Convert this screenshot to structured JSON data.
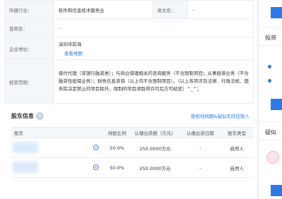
{
  "info": {
    "industry_label": "所属行业：",
    "industry_value": "软件和信息技术服务业",
    "en_name_label": "英文名：",
    "en_name_value": "-",
    "former_name_label": "曾用名：",
    "former_name_value": "-",
    "address_label": "企业地址：",
    "address_value": "深圳市前海",
    "map_link": "查看地图",
    "scope_label": "经营范围：",
    "scope_value": "保付代理（非银行融资类）；与商业保理相关的咨询服务（不含限制项目；从事担保业务（不含融资性担保业务）；财务信息咨询（以上均不含限制项目）。（以上各项涉及法律、行政法规、国务院决定禁止的项目除外，限制的项目须取得许可后方可经营）^_^；"
  },
  "shareholders": {
    "title": "股东信息",
    "count": "2",
    "link": "股权结构图&疑似实际控制人",
    "headers": [
      "股东",
      "持股比例",
      "认缴出资额（万元）",
      "认缴出资日期",
      "股东类型"
    ],
    "rows": [
      {
        "name": "",
        "ratio": "50.0%",
        "amount": "250.0000万元",
        "date": "-",
        "type": "自然人"
      },
      {
        "name": "",
        "ratio": "50.0%",
        "amount": "250.0000万元",
        "date": "-",
        "type": "自然人"
      }
    ]
  },
  "side": {
    "invest_title": "投资",
    "suspect_title": "疑似"
  }
}
